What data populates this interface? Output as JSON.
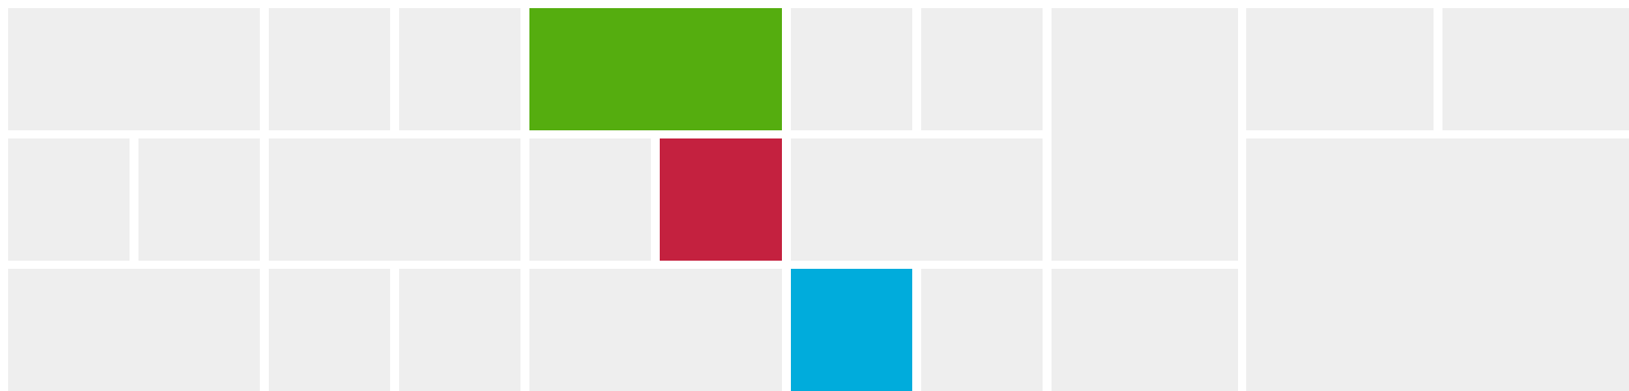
{
  "palette": {
    "background": "#ffffff",
    "tile": "#eeeeee",
    "green": "#55ad0f",
    "red": "#c4213f",
    "blue": "#00acdc"
  },
  "tiles": [
    {
      "id": "r1c1",
      "color": "tile"
    },
    {
      "id": "r1c2",
      "color": "tile"
    },
    {
      "id": "r1c3",
      "color": "tile"
    },
    {
      "id": "r1c4",
      "color": "green"
    },
    {
      "id": "r1c5",
      "color": "tile"
    },
    {
      "id": "r1c6",
      "color": "tile"
    },
    {
      "id": "tall-col",
      "color": "tile"
    },
    {
      "id": "r1c8",
      "color": "tile"
    },
    {
      "id": "r1c9",
      "color": "tile"
    },
    {
      "id": "r2c1",
      "color": "tile"
    },
    {
      "id": "r2c2",
      "color": "tile"
    },
    {
      "id": "r2c3",
      "color": "tile"
    },
    {
      "id": "r2c4",
      "color": "tile"
    },
    {
      "id": "r2c5",
      "color": "red"
    },
    {
      "id": "r2c6",
      "color": "tile"
    },
    {
      "id": "big-right",
      "color": "tile"
    },
    {
      "id": "r3c1",
      "color": "tile"
    },
    {
      "id": "r3c2",
      "color": "tile"
    },
    {
      "id": "r3c3",
      "color": "tile"
    },
    {
      "id": "r3c4",
      "color": "tile"
    },
    {
      "id": "r3c5",
      "color": "blue"
    },
    {
      "id": "r3c6",
      "color": "tile"
    },
    {
      "id": "r3c7",
      "color": "tile"
    }
  ]
}
